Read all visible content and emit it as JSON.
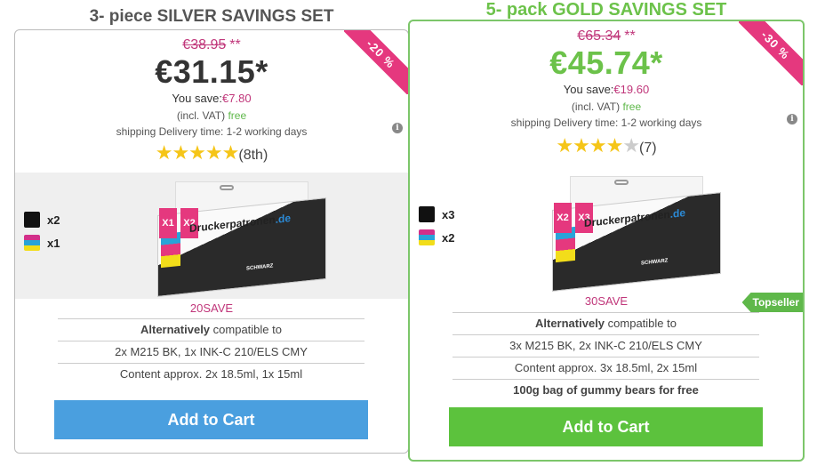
{
  "silver": {
    "title": "3- piece SILVER SAVINGS SET",
    "ribbon": "-20 %",
    "old_price": "€38.95",
    "old_price_mark": "**",
    "price": "€31.15*",
    "save_label": "You save:",
    "save_amount": "€7.80",
    "vat_label": "(incl. VAT)",
    "vat_shipping": "free",
    "delivery": "shipping Delivery time: 1-2 working days",
    "stars": 5,
    "rating_count": "(8th)",
    "items": [
      {
        "swatch": "black",
        "qty": "x2"
      },
      {
        "swatch": "color",
        "qty": "x1"
      }
    ],
    "box_tags": [
      "X1",
      "X2"
    ],
    "box_brand": "Druckerpatronen",
    "box_brand_domain": ".de",
    "box_label": "SCHWARZ",
    "code": "20SAVE",
    "details": [
      {
        "bold": "Alternatively",
        "text": " compatible to"
      },
      {
        "bold": "",
        "text": "2x M215 BK, 1x INK-C 210/ELS CMY"
      },
      {
        "bold": "",
        "text": "Content approx. 2x 18.5ml, 1x 15ml"
      }
    ],
    "button": "Add to Cart",
    "accent": "#4a9fdf"
  },
  "gold": {
    "title": "5- pack GOLD SAVINGS SET",
    "ribbon": "-30 %",
    "old_price": "€65.34",
    "old_price_mark": "**",
    "price": "€45.74*",
    "save_label": "You save:",
    "save_amount": "€19.60",
    "vat_label": "(incl. VAT)",
    "vat_shipping": "free",
    "delivery": "shipping Delivery time: 1-2 working days",
    "stars": 4,
    "rating_count": "(7)",
    "items": [
      {
        "swatch": "black",
        "qty": "x3"
      },
      {
        "swatch": "color",
        "qty": "x2"
      }
    ],
    "box_tags": [
      "X2",
      "X3"
    ],
    "box_brand": "Druckerpatronen",
    "box_brand_domain": ".de",
    "box_label": "SCHWARZ",
    "code": "30SAVE",
    "badge": "Topseller",
    "details": [
      {
        "bold": "Alternatively",
        "text": " compatible to"
      },
      {
        "bold": "",
        "text": "3x M215 BK, 2x INK-C 210/ELS CMY"
      },
      {
        "bold": "",
        "text": "Content approx. 3x 18.5ml, 2x 15ml"
      },
      {
        "bold": "100g bag of gummy bears for free",
        "text": ""
      }
    ],
    "button": "Add to Cart",
    "accent": "#5cc23d"
  },
  "info_icon": "info-icon",
  "colors": {
    "brand_pink": "#c0367a",
    "gold_green": "#6cc24a",
    "star": "#f5c518"
  }
}
